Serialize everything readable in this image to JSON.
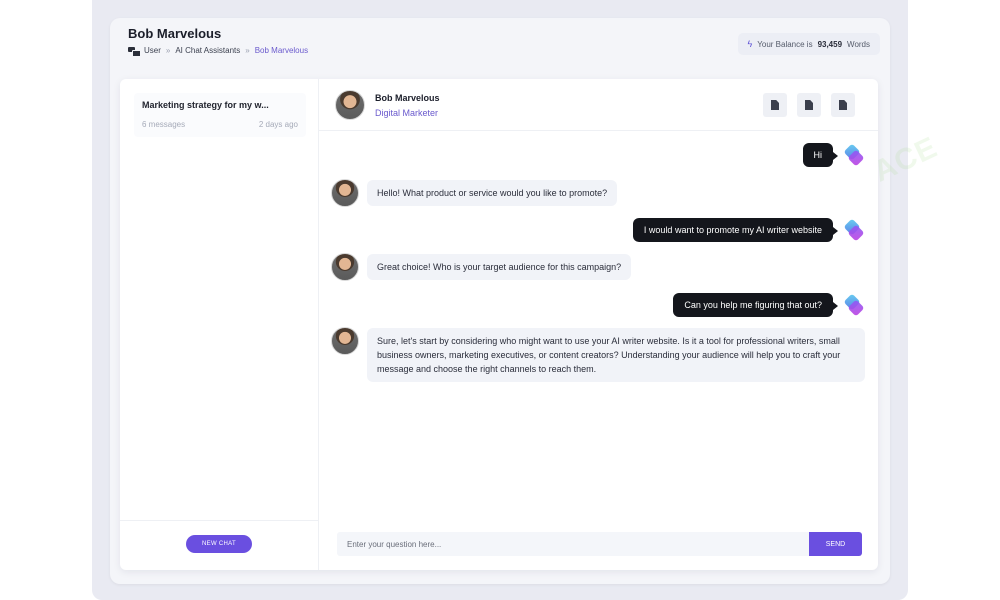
{
  "header": {
    "title": "Bob Marvelous",
    "breadcrumb": [
      "User",
      "AI Chat Assistants",
      "Bob Marvelous"
    ],
    "balance_prefix": "Your Balance is",
    "balance_value": "93,459",
    "balance_unit": "Words"
  },
  "sidebar": {
    "conversation": {
      "title": "Marketing strategy for my w...",
      "messages": "6 messages",
      "time": "2 days ago"
    },
    "new_chat_label": "NEW CHAT"
  },
  "chat": {
    "assistant_name": "Bob Marvelous",
    "assistant_role": "Digital Marketer",
    "header_icons": [
      "document-icon",
      "document-icon",
      "document-icon"
    ],
    "messages": [
      {
        "from": "user",
        "text": "Hi"
      },
      {
        "from": "assistant",
        "text": "Hello! What product or service would you like to promote?"
      },
      {
        "from": "user",
        "text": "I would want to promote my AI writer website"
      },
      {
        "from": "assistant",
        "text": "Great choice! Who is your target audience for this campaign?"
      },
      {
        "from": "user",
        "text": "Can you help me figuring that out?"
      },
      {
        "from": "assistant",
        "text": "Sure, let's start by considering who might want to use your AI writer website. Is it a tool for professional writers, small business owners, marketing executives, or content creators? Understanding your audience will help you to craft your message and choose the right channels to reach them."
      }
    ],
    "input_placeholder": "Enter your question here...",
    "send_label": "SEND"
  },
  "colors": {
    "accent": "#6a4fe0",
    "user_bubble": "#14161c",
    "assistant_bubble": "#f1f3f8"
  },
  "watermark": "AI TALENT SPACE"
}
